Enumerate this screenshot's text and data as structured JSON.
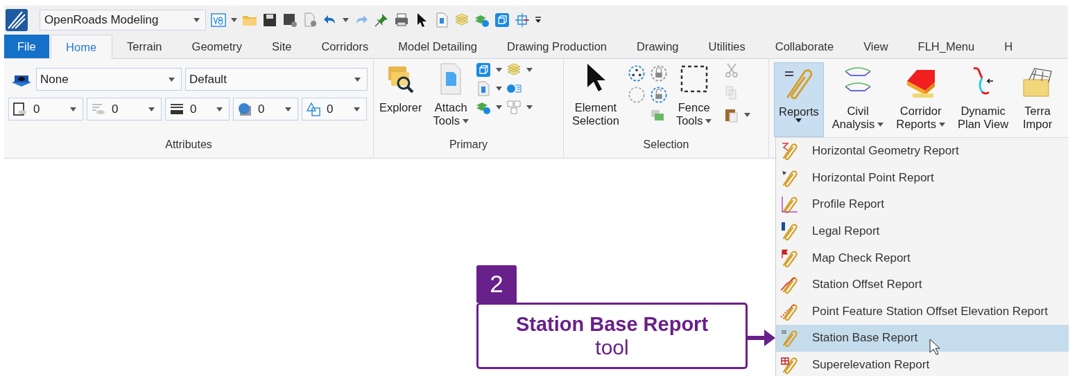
{
  "quick_access_toolbar": {
    "workspace": "OpenRoads Modeling"
  },
  "ribbon_tabs": [
    {
      "label": "File",
      "kind": "backstage",
      "selected": false
    },
    {
      "label": "Home",
      "kind": "tab",
      "selected": true
    },
    {
      "label": "Terrain",
      "kind": "tab",
      "selected": false
    },
    {
      "label": "Geometry",
      "kind": "tab",
      "selected": false
    },
    {
      "label": "Site",
      "kind": "tab",
      "selected": false
    },
    {
      "label": "Corridors",
      "kind": "tab",
      "selected": false
    },
    {
      "label": "Model Detailing",
      "kind": "tab",
      "selected": false
    },
    {
      "label": "Drawing Production",
      "kind": "tab",
      "selected": false
    },
    {
      "label": "Drawing",
      "kind": "tab",
      "selected": false
    },
    {
      "label": "Utilities",
      "kind": "tab",
      "selected": false
    },
    {
      "label": "Collaborate",
      "kind": "tab",
      "selected": false
    },
    {
      "label": "View",
      "kind": "tab",
      "selected": false
    },
    {
      "label": "FLH_Menu",
      "kind": "tab",
      "selected": false
    },
    {
      "label": "H",
      "kind": "tab",
      "selected": false
    }
  ],
  "ribbon_groups": [
    {
      "label": "Attributes",
      "kind": "attributes",
      "level_fields": [
        {
          "value": "None"
        },
        {
          "value": "Default"
        }
      ],
      "attribute_fields": [
        {
          "value": "0"
        },
        {
          "value": "0"
        },
        {
          "value": "0"
        },
        {
          "value": "0"
        },
        {
          "value": "0"
        }
      ]
    },
    {
      "label": "Primary",
      "kind": "primary",
      "large_buttons": [
        {
          "lines": [
            "Explorer"
          ],
          "has_menu": false,
          "pressed": false
        },
        {
          "lines": [
            "Attach",
            "Tools"
          ],
          "has_menu": true,
          "pressed": false
        }
      ]
    },
    {
      "label": "Selection",
      "kind": "selection",
      "large_buttons": [
        {
          "lines": [
            "Element",
            "Selection"
          ],
          "has_menu": false,
          "pressed": false
        },
        {
          "lines": [
            "Fence",
            "Tools"
          ],
          "has_menu": true,
          "pressed": false
        }
      ]
    },
    {
      "kind": "civil",
      "large_buttons": [
        {
          "lines": [
            "Reports"
          ],
          "has_menu": true,
          "pressed": true
        },
        {
          "lines": [
            "Civil",
            "Analysis"
          ],
          "has_menu": true,
          "pressed": false
        },
        {
          "lines": [
            "Corridor",
            "Reports"
          ],
          "has_menu": true,
          "pressed": false
        },
        {
          "lines": [
            "Dynamic",
            "Plan View"
          ],
          "has_menu": false,
          "pressed": false
        },
        {
          "lines": [
            "Terra",
            "Impor"
          ],
          "has_menu": false,
          "pressed": false
        }
      ]
    }
  ],
  "reports_menu": {
    "items": [
      {
        "label": "Horizontal Geometry Report",
        "selected": false
      },
      {
        "label": "Horizontal Point Report",
        "selected": false
      },
      {
        "label": "Profile Report",
        "selected": false
      },
      {
        "label": "Legal Report",
        "selected": false
      },
      {
        "label": "Map Check Report",
        "selected": false
      },
      {
        "label": "Station Offset Report",
        "selected": false
      },
      {
        "label": "Point Feature Station Offset Elevation Report",
        "selected": false
      },
      {
        "label": "Station Base Report",
        "selected": true
      },
      {
        "label": "Superelevation Report",
        "selected": false
      }
    ]
  },
  "callout": {
    "number": "2",
    "title": "Station Base Report",
    "subtitle": "tool"
  }
}
